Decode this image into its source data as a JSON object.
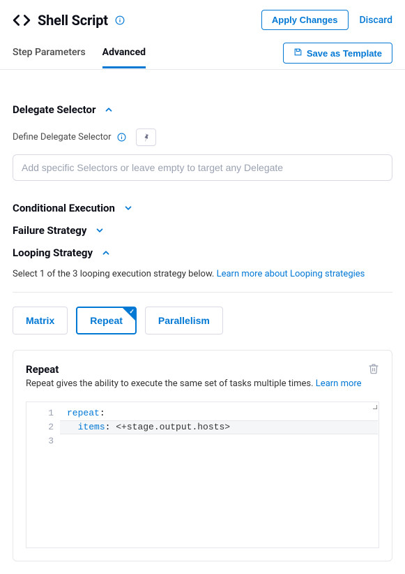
{
  "header": {
    "title": "Shell Script",
    "apply_label": "Apply Changes",
    "discard_label": "Discard"
  },
  "tabs": {
    "step_parameters": "Step Parameters",
    "advanced": "Advanced",
    "save_template": "Save as Template"
  },
  "delegate": {
    "title": "Delegate Selector",
    "sub_label": "Define Delegate Selector",
    "placeholder": "Add specific Selectors or leave empty to target any Delegate"
  },
  "conditional": {
    "title": "Conditional Execution"
  },
  "failure": {
    "title": "Failure Strategy"
  },
  "looping": {
    "title": "Looping Strategy",
    "desc_prefix": "Select 1 of the 3 looping execution strategy below. ",
    "learn_more": "Learn more about Looping strategies",
    "options": {
      "matrix": "Matrix",
      "repeat": "Repeat",
      "parallelism": "Parallelism"
    }
  },
  "repeat_box": {
    "title": "Repeat",
    "desc_prefix": "Repeat gives the ability to execute the same set of tasks multiple times. ",
    "learn_more": "Learn more",
    "code": {
      "l1_key": "repeat",
      "l2_key": "items",
      "l2_val": "<+stage.output.hosts>",
      "ln1": "1",
      "ln2": "2",
      "ln3": "3"
    }
  }
}
